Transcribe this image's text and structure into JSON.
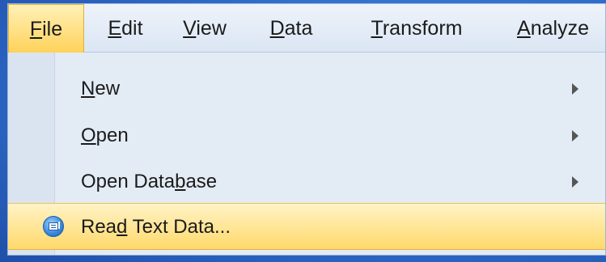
{
  "menubar": {
    "items": [
      {
        "pre": "",
        "mn": "F",
        "post": "ile",
        "active": true
      },
      {
        "pre": "",
        "mn": "E",
        "post": "dit",
        "active": false
      },
      {
        "pre": "",
        "mn": "V",
        "post": "iew",
        "active": false
      },
      {
        "pre": "",
        "mn": "D",
        "post": "ata",
        "active": false
      },
      {
        "pre": "",
        "mn": "T",
        "post": "ransform",
        "active": false
      },
      {
        "pre": "",
        "mn": "A",
        "post": "nalyze",
        "active": false
      }
    ]
  },
  "file_menu": {
    "items": [
      {
        "pre": "",
        "mn": "N",
        "post": "ew",
        "submenu": true,
        "icon": "",
        "highlighted": false
      },
      {
        "pre": "",
        "mn": "O",
        "post": "pen",
        "submenu": true,
        "icon": "",
        "highlighted": false
      },
      {
        "pre": "Open Data",
        "mn": "b",
        "post": "ase",
        "submenu": true,
        "icon": "",
        "highlighted": false
      },
      {
        "pre": "Rea",
        "mn": "d",
        "post": " Text Data...",
        "submenu": false,
        "icon": "read-text-data-icon",
        "highlighted": true
      }
    ]
  },
  "colors": {
    "highlight": "#ffd96b",
    "menu_bg": "#e3ebf5",
    "desktop": "#3a78d6"
  }
}
